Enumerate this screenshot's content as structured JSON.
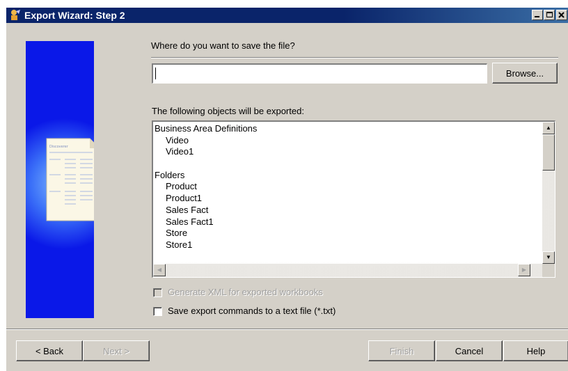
{
  "window": {
    "title": "Export Wizard: Step 2",
    "icons": [
      "wizard-app-icon",
      "minimize-icon",
      "maximize-icon",
      "close-icon"
    ]
  },
  "side_panel": {
    "image_heading": "Discoverer",
    "icon": "export-document-arrow-illustration"
  },
  "save_location": {
    "prompt": "Where do you want to save the file?",
    "value": "",
    "browse_label": "Browse..."
  },
  "objects": {
    "heading": "The following objects will be exported:",
    "items": [
      {
        "text": "Business Area Definitions",
        "indent": false
      },
      {
        "text": "Video",
        "indent": true
      },
      {
        "text": "Video1",
        "indent": true
      },
      {
        "text": "",
        "indent": false
      },
      {
        "text": "Folders",
        "indent": false
      },
      {
        "text": "Product",
        "indent": true
      },
      {
        "text": "Product1",
        "indent": true
      },
      {
        "text": "Sales Fact",
        "indent": true
      },
      {
        "text": "Sales Fact1",
        "indent": true
      },
      {
        "text": "Store",
        "indent": true
      },
      {
        "text": "Store1",
        "indent": true
      }
    ]
  },
  "options": {
    "generate_xml": {
      "label": "Generate XML for exported workbooks",
      "checked": false,
      "enabled": false
    },
    "save_commands": {
      "label": "Save export commands to a text file (*.txt)",
      "checked": false,
      "enabled": true
    }
  },
  "buttons": {
    "back": "< Back",
    "next": "Next >",
    "finish": "Finish",
    "cancel": "Cancel",
    "help": "Help"
  }
}
